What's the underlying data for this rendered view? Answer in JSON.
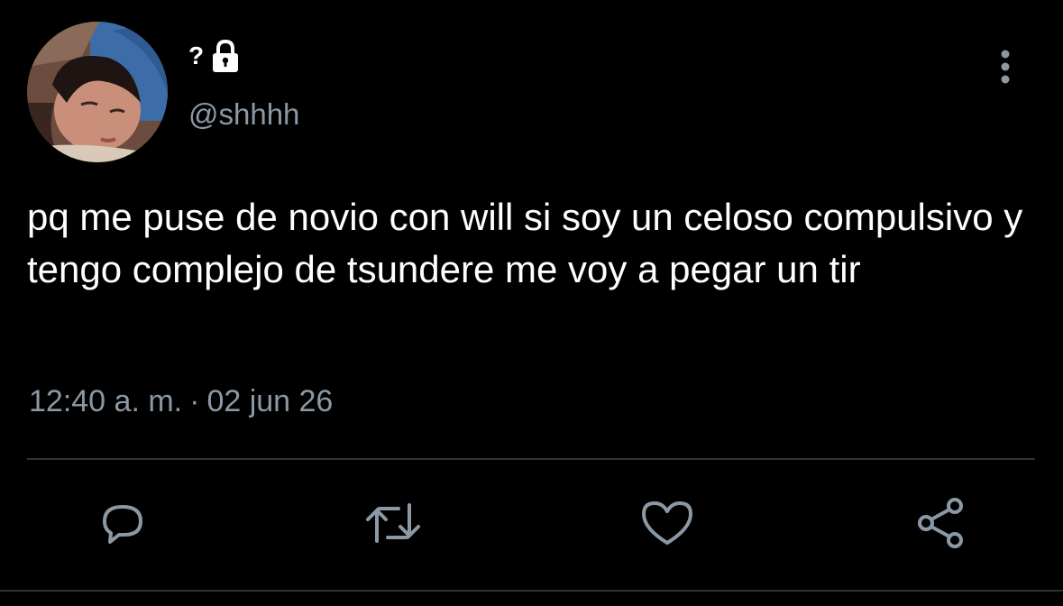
{
  "tweet": {
    "display_name": "?",
    "handle": "@shhhh",
    "text": "pq me puse de novio con will si soy un celoso compulsivo y tengo complejo de tsundere me voy a pegar un tir",
    "time": "12:40 a. m.",
    "separator": "·",
    "date": "02 jun 26"
  },
  "icons": {
    "lock": "lock-icon",
    "more": "more-vertical-icon",
    "reply": "reply-icon",
    "retweet": "retweet-icon",
    "like": "heart-icon",
    "share": "share-icon"
  },
  "colors": {
    "background": "#000000",
    "text": "#ffffff",
    "secondary": "#8b98a5",
    "divider": "#2f3336"
  }
}
